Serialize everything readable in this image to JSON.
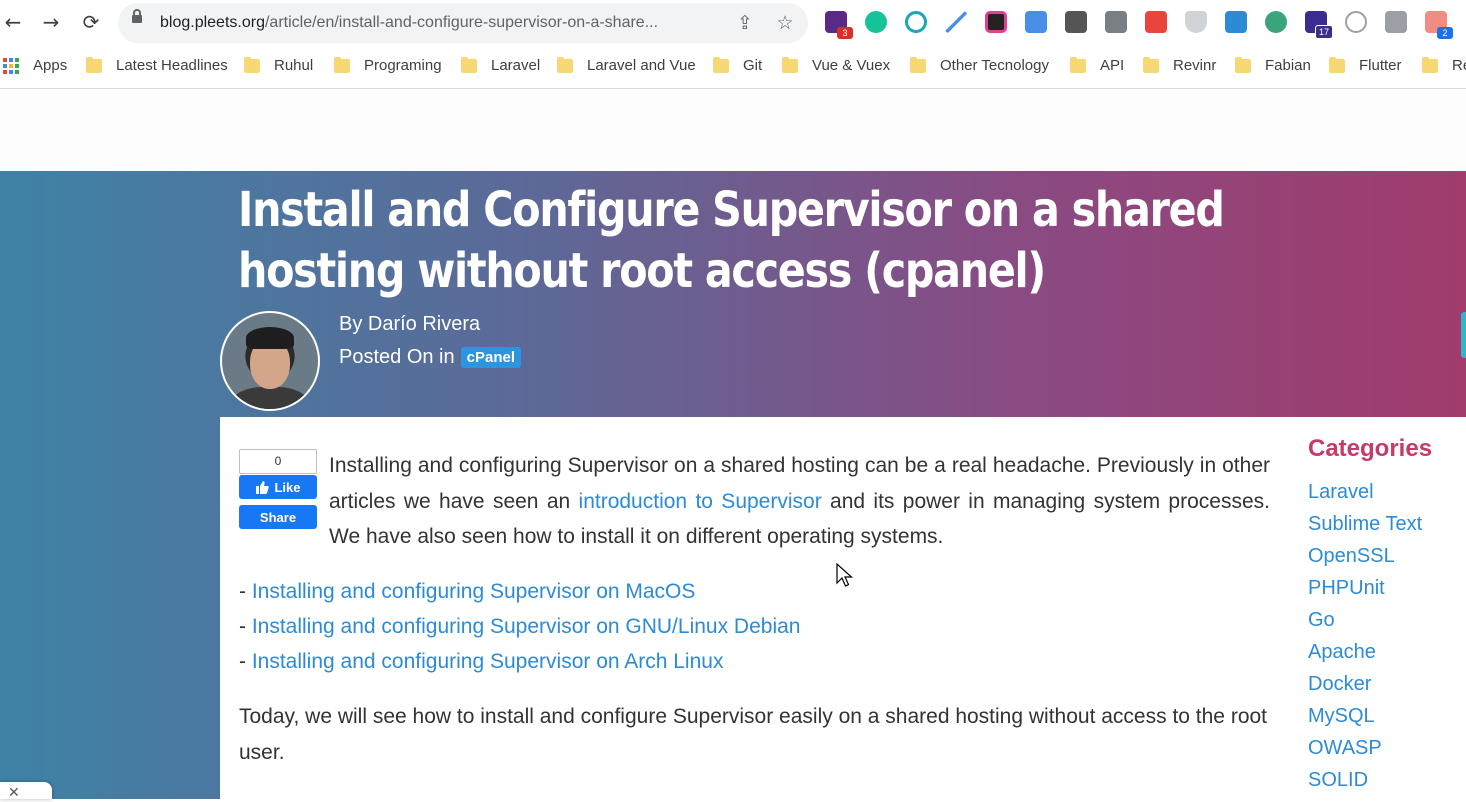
{
  "browser": {
    "url_host": "blog.pleets.org",
    "url_path": "/article/en/install-and-configure-supervisor-on-a-share...",
    "extension_badges": {
      "first": "3",
      "classroom": "17",
      "last": "2"
    }
  },
  "bookmarks": [
    "Apps",
    "Latest Headlines",
    "Ruhul",
    "Programing",
    "Laravel",
    "Laravel and Vue",
    "Git",
    "Vue & Vuex",
    "Other Tecnology",
    "API",
    "Revinr",
    "Fabian",
    "Flutter",
    "Re"
  ],
  "article": {
    "title": "Install and Configure Supervisor on a shared hosting without root access (cpanel)",
    "author": "By Darío Rivera",
    "posted_prefix": "Posted On in",
    "category_tag": "cPanel",
    "fb": {
      "count": "0",
      "like": "Like",
      "share": "Share"
    },
    "intro_before": "Installing and configuring Supervisor on a shared hosting can be a real headache. Previously in other articles we have seen an ",
    "intro_link": "introduction to Supervisor",
    "intro_after": " and its power in managing system processes. We have also seen how to install it on different operating systems.",
    "list_prefix": "- ",
    "links": [
      "Installing and configuring Supervisor on MacOS",
      "Installing and configuring Supervisor on GNU/Linux Debian",
      "Installing and configuring Supervisor on Arch Linux"
    ],
    "paragraph2": "Today, we will see how to install and configure Supervisor easily on a shared hosting without access to the root user."
  },
  "sidebar": {
    "title": "Categories",
    "items": [
      "Laravel",
      "Sublime Text",
      "OpenSSL",
      "PHPUnit",
      "Go",
      "Apache",
      "Docker",
      "MySQL",
      "OWASP",
      "SOLID"
    ]
  },
  "colors": {
    "hero_gradient": [
      "#3f82a6",
      "#a13c6c"
    ],
    "link": "#2d8bd6",
    "category_title": "#c53a6a",
    "fb_blue": "#1877f2"
  }
}
